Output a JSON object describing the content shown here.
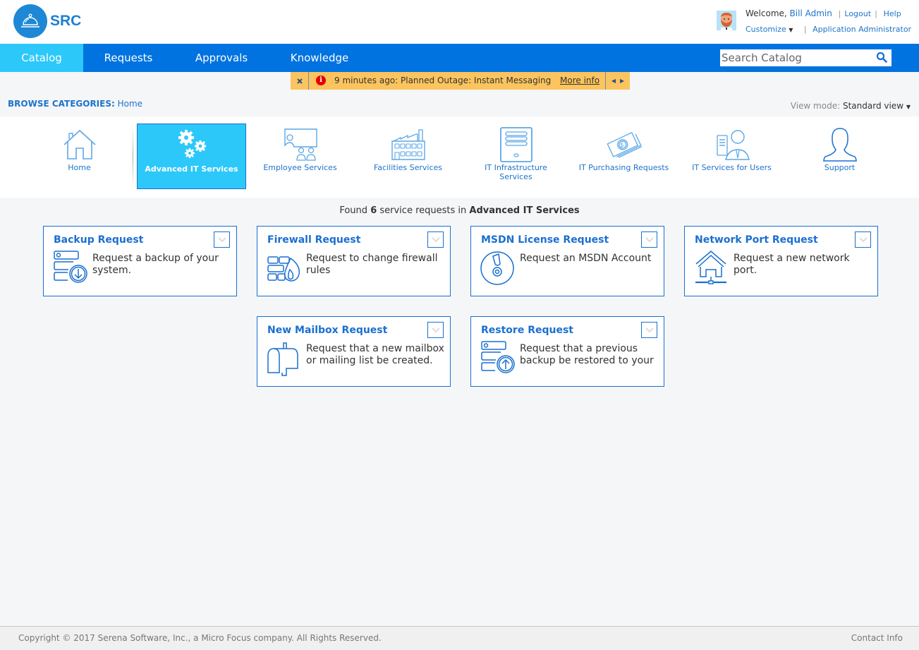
{
  "header": {
    "logo_text": "SRC",
    "welcome_prefix": "Welcome,",
    "user_name": "Bill Admin",
    "logout": "Logout",
    "help": "Help",
    "customize": "Customize",
    "role": "Application Administrator"
  },
  "nav": {
    "items": [
      {
        "label": "Catalog",
        "active": true
      },
      {
        "label": "Requests",
        "active": false
      },
      {
        "label": "Approvals",
        "active": false
      },
      {
        "label": "Knowledge",
        "active": false
      }
    ],
    "search_placeholder": "Search Catalog",
    "search_value": ""
  },
  "announcement": {
    "text": "9 minutes ago: Planned Outage: Instant Messaging",
    "more_info": "More info"
  },
  "breadcrumb": {
    "label": "BROWSE CATEGORIES:",
    "current": "Home"
  },
  "view_mode": {
    "label": "View mode:",
    "value": "Standard view"
  },
  "categories": [
    {
      "label": "Home",
      "icon": "home-icon",
      "active": false
    },
    {
      "label": "Advanced IT Services",
      "icon": "gears-icon",
      "active": true
    },
    {
      "label": "Employee Services",
      "icon": "presentation-icon",
      "active": false
    },
    {
      "label": "Facilities Services",
      "icon": "factory-icon",
      "active": false
    },
    {
      "label": "IT Infrastructure Services",
      "icon": "server-icon",
      "active": false
    },
    {
      "label": "IT Purchasing Requests",
      "icon": "money-icon",
      "active": false
    },
    {
      "label": "IT Services for Users",
      "icon": "user-computer-icon",
      "active": false
    },
    {
      "label": "Support",
      "icon": "person-icon",
      "active": false
    }
  ],
  "results": {
    "prefix": "Found",
    "count": "6",
    "middle": "service requests  in",
    "category": "Advanced IT Services"
  },
  "services": [
    {
      "title": "Backup Request",
      "description": "Request a backup of your system.",
      "icon": "backup-icon"
    },
    {
      "title": "Firewall Request",
      "description": "Request to change firewall rules",
      "icon": "firewall-icon"
    },
    {
      "title": "MSDN License Request",
      "description": "Request an MSDN Account",
      "icon": "disc-icon"
    },
    {
      "title": "Network Port Request",
      "description": "Request a new network port.",
      "icon": "network-house-icon"
    },
    {
      "title": "New Mailbox Request",
      "description": "Request that a new mailbox or mailing list be created.",
      "icon": "mailbox-icon"
    },
    {
      "title": "Restore Request",
      "description": "Request that a previous backup be restored to your system.",
      "icon": "restore-icon"
    }
  ],
  "footer": {
    "copyright": "Copyright © 2017 Serena Software, Inc., a Micro Focus company. All Rights Reserved.",
    "contact": "Contact Info"
  },
  "colors": {
    "nav_bg": "#0073e0",
    "nav_active": "#2cc8fa",
    "accent": "#1a6fd0",
    "announcement_bg": "#fcc45e"
  }
}
